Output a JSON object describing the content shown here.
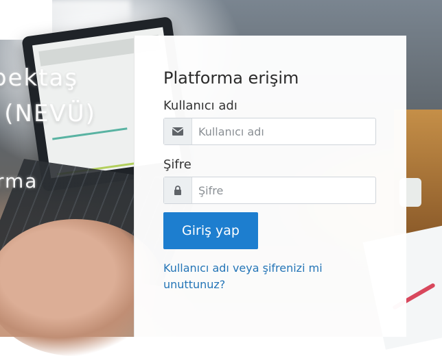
{
  "brand": {
    "line1": "bektaş",
    "line2": "i (NEVÜ)",
    "line3": "rma"
  },
  "login": {
    "title": "Platforma erişim",
    "username_label": "Kullanıcı adı",
    "username_placeholder": "Kullanıcı adı",
    "password_label": "Şifre",
    "password_placeholder": "Şifre",
    "submit_label": "Giriş yap",
    "forgot_link": "Kullanıcı adı veya şifrenizi mi unuttunuz?"
  },
  "icons": {
    "username": "envelope-icon",
    "password": "lock-icon"
  },
  "colors": {
    "primary": "#1d7ecf",
    "link": "#2475b7",
    "panel": "#ffffff"
  }
}
